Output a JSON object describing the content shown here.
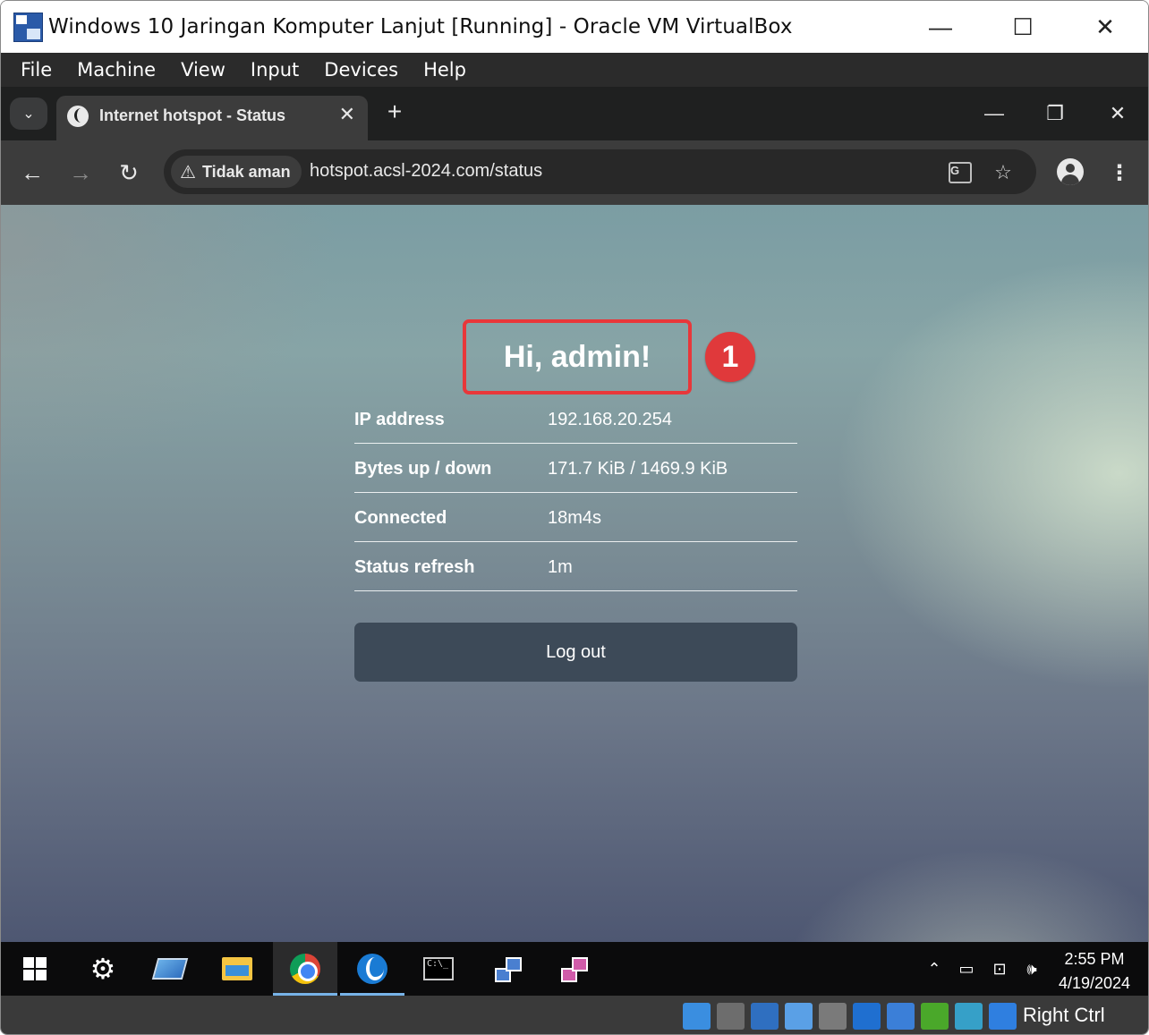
{
  "window": {
    "title": "Windows 10 Jaringan Komputer Lanjut [Running] - Oracle VM VirtualBox",
    "minimize": "—",
    "maximize": "☐",
    "close": "✕"
  },
  "vbox_menu": [
    "File",
    "Machine",
    "View",
    "Input",
    "Devices",
    "Help"
  ],
  "browser": {
    "tab_title": "Internet hotspot - Status",
    "tab_close": "✕",
    "new_tab": "+",
    "security_label": "Tidak aman",
    "url": "hotspot.acsl-2024.com/status",
    "icons": [
      "tab-search-icon",
      "back-icon",
      "forward-icon",
      "reload-icon",
      "warning-icon",
      "translate-icon",
      "star-icon",
      "profile-icon",
      "menu-icon"
    ]
  },
  "page": {
    "greeting": "Hi, admin!",
    "annotation_number": "1",
    "rows": [
      {
        "label": "IP address",
        "value": "192.168.20.254"
      },
      {
        "label": "Bytes up / down",
        "value": "171.7 KiB / 1469.9 KiB"
      },
      {
        "label": "Connected",
        "value": "18m4s"
      },
      {
        "label": "Status refresh",
        "value": "1m"
      }
    ],
    "logout_label": "Log out"
  },
  "taskbar": {
    "apps": [
      "start-icon",
      "settings-icon",
      "this-pc-icon",
      "file-explorer-icon",
      "chrome-icon",
      "winbox-icon",
      "cmd-icon",
      "network-icon",
      "server-icon"
    ],
    "time": "2:55 PM",
    "date": "4/19/2024"
  },
  "vbox_status": {
    "host_key": "Right Ctrl"
  },
  "colors": {
    "annotation_red": "#e0393b",
    "logout_bg": "#3d4a58"
  }
}
